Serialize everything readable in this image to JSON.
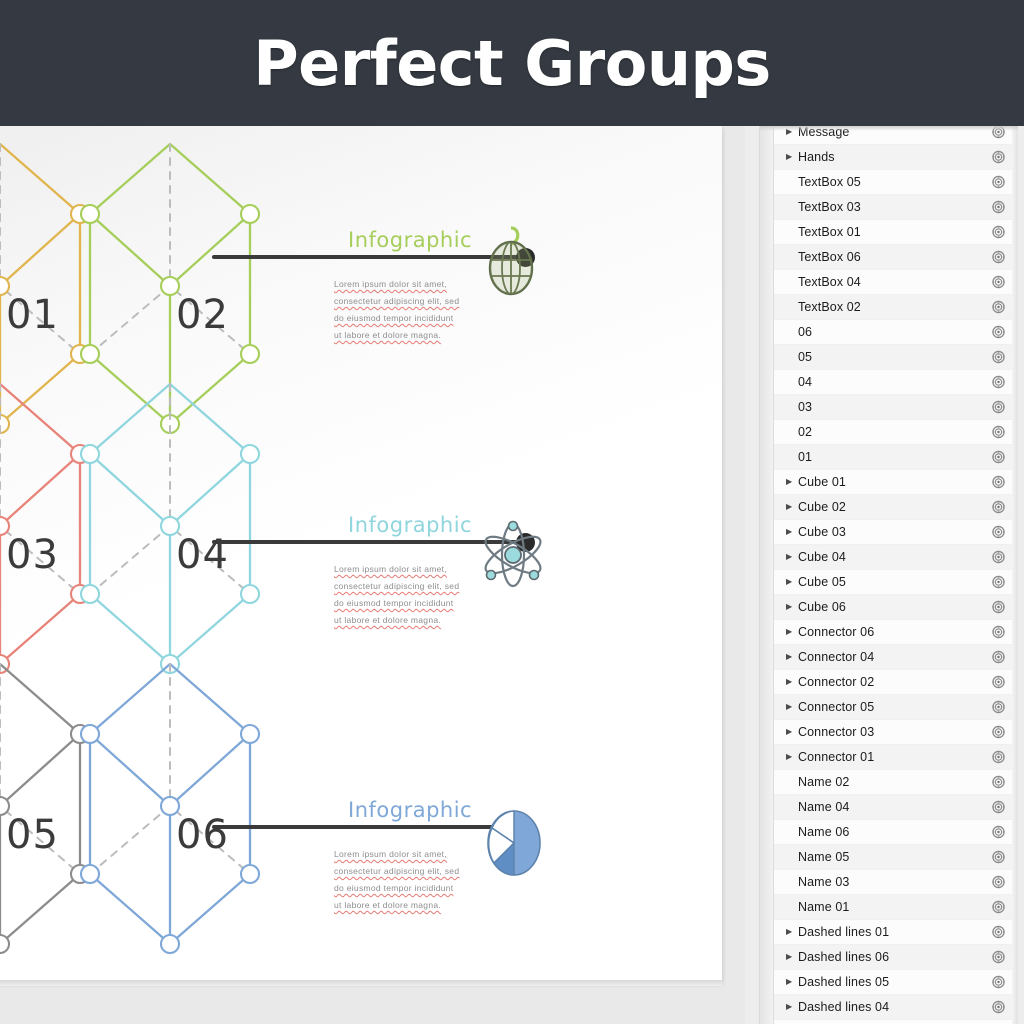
{
  "titlebar": {
    "title": "Perfect Groups"
  },
  "canvas": {
    "cubes": [
      {
        "number": "01",
        "color": "#e0b54e"
      },
      {
        "number": "02",
        "color": "#a6ce5a"
      },
      {
        "number": "03",
        "color": "#e8837a"
      },
      {
        "number": "04",
        "color": "#8fd6de"
      },
      {
        "number": "05",
        "color": "#8c8c8c"
      },
      {
        "number": "06",
        "color": "#7fa8d8"
      }
    ],
    "infoblocks": [
      {
        "heading": "Infographic",
        "heading_color": "#a6ce5a",
        "icon": "globe-icon",
        "lines": [
          "Lorem ipsum dolor sit amet,",
          "consectetur adipiscing elit, sed",
          "do eiusmod tempor incididunt",
          "ut labore et dolore magna."
        ]
      },
      {
        "heading": "Infographic",
        "heading_color": "#8fd6de",
        "icon": "atom-icon",
        "lines": [
          "Lorem ipsum dolor sit amet,",
          "consectetur adipiscing elit, sed",
          "do eiusmod tempor incididunt",
          "ut labore et dolore magna."
        ]
      },
      {
        "heading": "Infographic",
        "heading_color": "#7fa8d8",
        "icon": "pie-chart-icon",
        "lines": [
          "Lorem ipsum dolor sit amet,",
          "consectetur adipiscing elit, sed",
          "do eiusmod tempor incididunt",
          "ut labore et dolore magna."
        ]
      }
    ]
  },
  "layers_panel": {
    "rows": [
      {
        "label": "Message",
        "expandable": true
      },
      {
        "label": "Hands",
        "expandable": true
      },
      {
        "label": "TextBox 05",
        "expandable": false
      },
      {
        "label": "TextBox 03",
        "expandable": false
      },
      {
        "label": "TextBox 01",
        "expandable": false
      },
      {
        "label": "TextBox 06",
        "expandable": false
      },
      {
        "label": "TextBox 04",
        "expandable": false
      },
      {
        "label": "TextBox 02",
        "expandable": false
      },
      {
        "label": "06",
        "expandable": false
      },
      {
        "label": "05",
        "expandable": false
      },
      {
        "label": "04",
        "expandable": false
      },
      {
        "label": "03",
        "expandable": false
      },
      {
        "label": "02",
        "expandable": false
      },
      {
        "label": "01",
        "expandable": false
      },
      {
        "label": "Cube 01",
        "expandable": true
      },
      {
        "label": "Cube 02",
        "expandable": true
      },
      {
        "label": "Cube 03",
        "expandable": true
      },
      {
        "label": "Cube 04",
        "expandable": true
      },
      {
        "label": "Cube 05",
        "expandable": true
      },
      {
        "label": "Cube 06",
        "expandable": true
      },
      {
        "label": "Connector 06",
        "expandable": true
      },
      {
        "label": "Connector 04",
        "expandable": true
      },
      {
        "label": "Connector 02",
        "expandable": true
      },
      {
        "label": "Connector 05",
        "expandable": true
      },
      {
        "label": "Connector 03",
        "expandable": true
      },
      {
        "label": "Connector 01",
        "expandable": true
      },
      {
        "label": "Name 02",
        "expandable": false
      },
      {
        "label": "Name 04",
        "expandable": false
      },
      {
        "label": "Name 06",
        "expandable": false
      },
      {
        "label": "Name 05",
        "expandable": false
      },
      {
        "label": "Name 03",
        "expandable": false
      },
      {
        "label": "Name 01",
        "expandable": false
      },
      {
        "label": "Dashed lines 01",
        "expandable": true
      },
      {
        "label": "Dashed lines 06",
        "expandable": true
      },
      {
        "label": "Dashed lines 05",
        "expandable": true
      },
      {
        "label": "Dashed lines 04",
        "expandable": true
      }
    ]
  }
}
